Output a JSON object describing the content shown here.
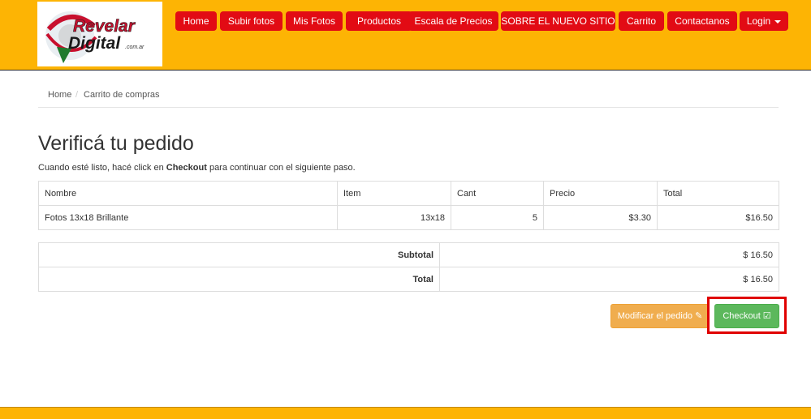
{
  "brand": {
    "logo_text_top": "Revelar",
    "logo_text_bottom": "Digital",
    "logo_suffix": ".com.ar",
    "colors": {
      "header": "#fdb404",
      "nav": "#e20b14",
      "checkout": "#5cb85c",
      "modify": "#f0ad4e",
      "highlight": "#e00000"
    }
  },
  "nav": {
    "items": [
      {
        "label": "Home"
      },
      {
        "label": "Subir fotos"
      },
      {
        "label": "Mis Fotos"
      },
      {
        "label": "Productos"
      },
      {
        "label": "Escala de Precios"
      },
      {
        "label": "SOBRE EL NUEVO SITIO"
      },
      {
        "label": "Carrito"
      },
      {
        "label": "Contactanos"
      },
      {
        "label": "Login",
        "icon": "caret-down-icon"
      }
    ]
  },
  "breadcrumb": {
    "home": "Home",
    "separator": "/",
    "current": "Carrito de compras"
  },
  "main": {
    "title": "Verificá tu pedido",
    "intro_before": "Cuando esté listo, hacé click en ",
    "intro_bold": "Checkout",
    "intro_after": " para continuar con el siguiente paso."
  },
  "order": {
    "headers": [
      "Nombre",
      "Item",
      "Cant",
      "Precio",
      "Total"
    ],
    "rows": [
      [
        "Fotos 13x18 Brillante",
        "13x18",
        "5",
        "$3.30",
        "$16.50"
      ]
    ]
  },
  "totals": {
    "subtotal_label": "Subtotal",
    "subtotal_value": "$ 16.50",
    "total_label": "Total",
    "total_value": "$ 16.50"
  },
  "actions": {
    "modify_label": "Modificar el pedido",
    "modify_icon": "edit-icon",
    "checkout_label": "Checkout",
    "checkout_icon": "check-square-icon"
  }
}
